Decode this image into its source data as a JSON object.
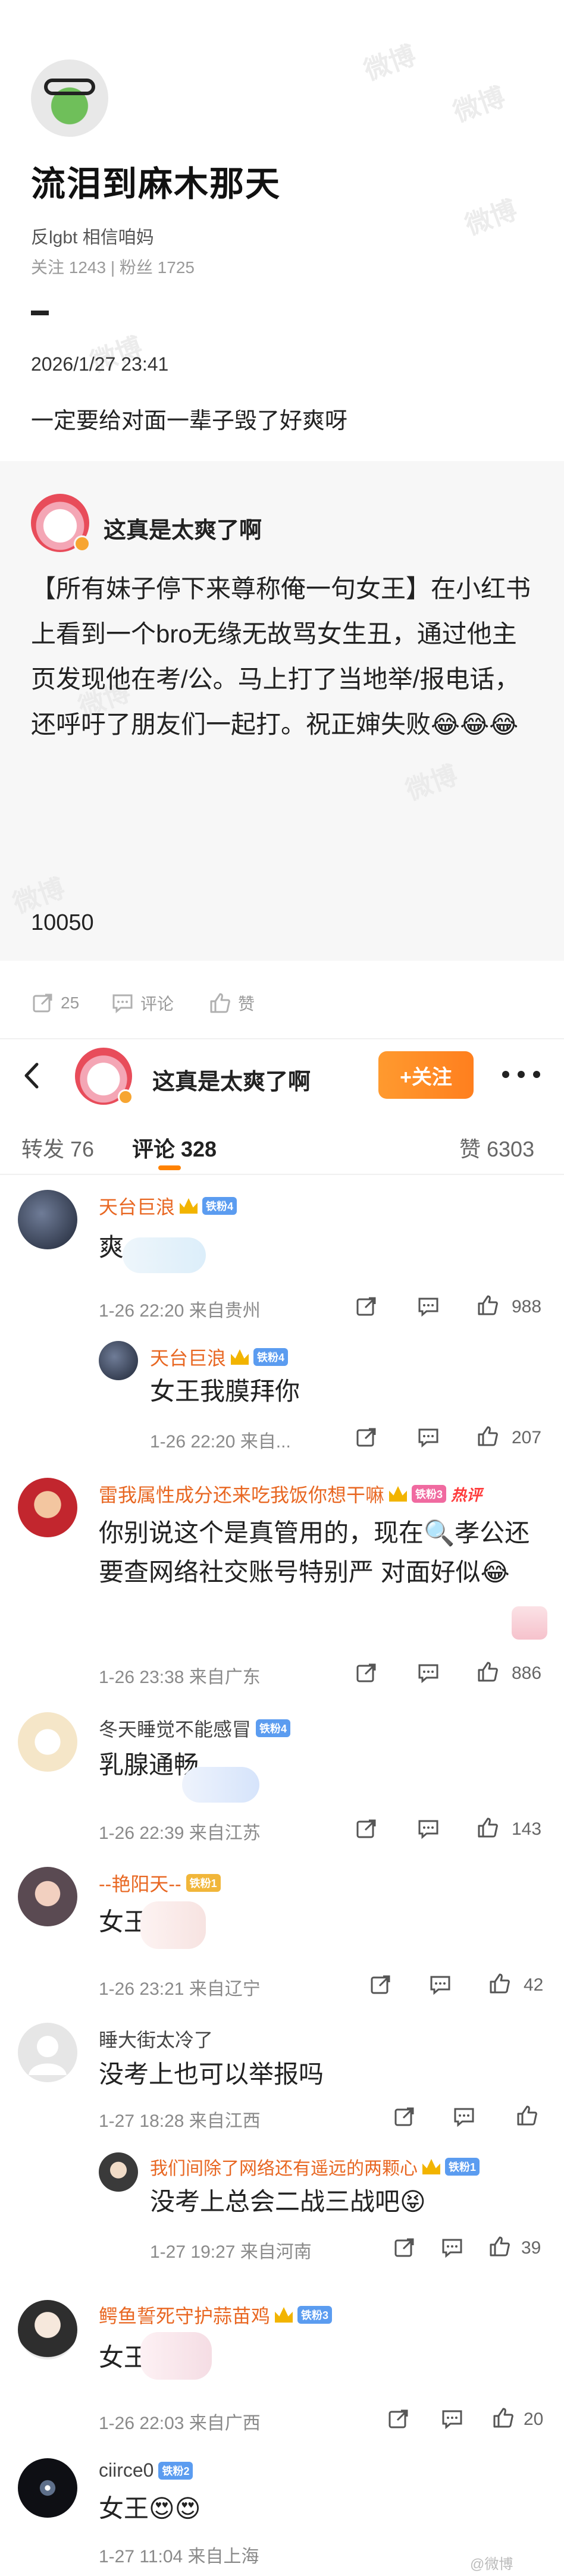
{
  "post": {
    "title": "流泪到麻木那天",
    "bio": "反lgbt 相信咱妈",
    "stats": "关注 1243 | 粉丝 1725",
    "time": "2026/1/27 23:41",
    "text": "一定要给对面一辈子毁了好爽呀",
    "watermark": "微博"
  },
  "quote": {
    "author": "这真是太爽了啊",
    "body": "【所有妹子停下来尊称俺一句女王】在小红书上看到一个bro无缘无故骂女生丑，通过他主页发现他在考/公。马上打了当地举/报电话，还呼吁了朋友们一起打。祝正婶失败😂😂😂",
    "count": "10050"
  },
  "actions": {
    "repost": "25",
    "comment": "评论",
    "like": "赞"
  },
  "nav": {
    "name": "这真是太爽了啊",
    "follow": "+关注"
  },
  "tabs": {
    "repost": "转发 76",
    "comment": "评论 328",
    "like": "赞 6303"
  },
  "comments": [
    {
      "name": "天台巨浪",
      "badge": "铁粉4",
      "text": "爽",
      "meta": "1-26 22:20 来自贵州",
      "likes": "988",
      "reply": {
        "name": "天台巨浪",
        "badge": "铁粉4",
        "text": "女王我膜拜你",
        "meta": "1-26 22:20 来自...",
        "likes": "207"
      }
    },
    {
      "name": "雷我属性成分还来吃我饭你想干嘛",
      "badge": "铁粉3",
      "hot": "热评",
      "text": "你别说这个是真管用的，现在🔍孝公还要查网络社交账号特别严 对面好似😂",
      "meta": "1-26 23:38 来自广东",
      "likes": "886"
    },
    {
      "name": "冬天睡觉不能感冒",
      "badge": "铁粉4",
      "text": "乳腺通畅",
      "meta": "1-26 22:39 来自江苏",
      "likes": "143"
    },
    {
      "name": "--艳阳天--",
      "badge": "铁粉1",
      "text": "女王",
      "meta": "1-26 23:21 来自辽宁",
      "likes": "42"
    },
    {
      "name": "睡大街太冷了",
      "text": "没考上也可以举报吗",
      "meta": "1-27 18:28 来自江西",
      "likes": "",
      "reply": {
        "name": "我们间除了网络还有遥远的两颗心",
        "badge": "铁粉1",
        "text": "没考上总会二战三战吧😝",
        "meta": "1-27 19:27 来自河南",
        "likes": "39"
      }
    },
    {
      "name": "鳄鱼誓死守护蒜苗鸡",
      "badge": "铁粉3",
      "text": "女王",
      "meta": "1-26 22:03 来自广西",
      "likes": "20"
    },
    {
      "name": "ciirce0",
      "badge": "铁粉2",
      "text": "女王😍😍",
      "meta": "1-27 11:04 来自上海",
      "likes": ""
    }
  ],
  "footer": {
    "watermark": "@微博"
  },
  "colors": {
    "accent": "#ff8200",
    "name_orange": "#e86722",
    "vip_blue": "#5b9cf0"
  }
}
